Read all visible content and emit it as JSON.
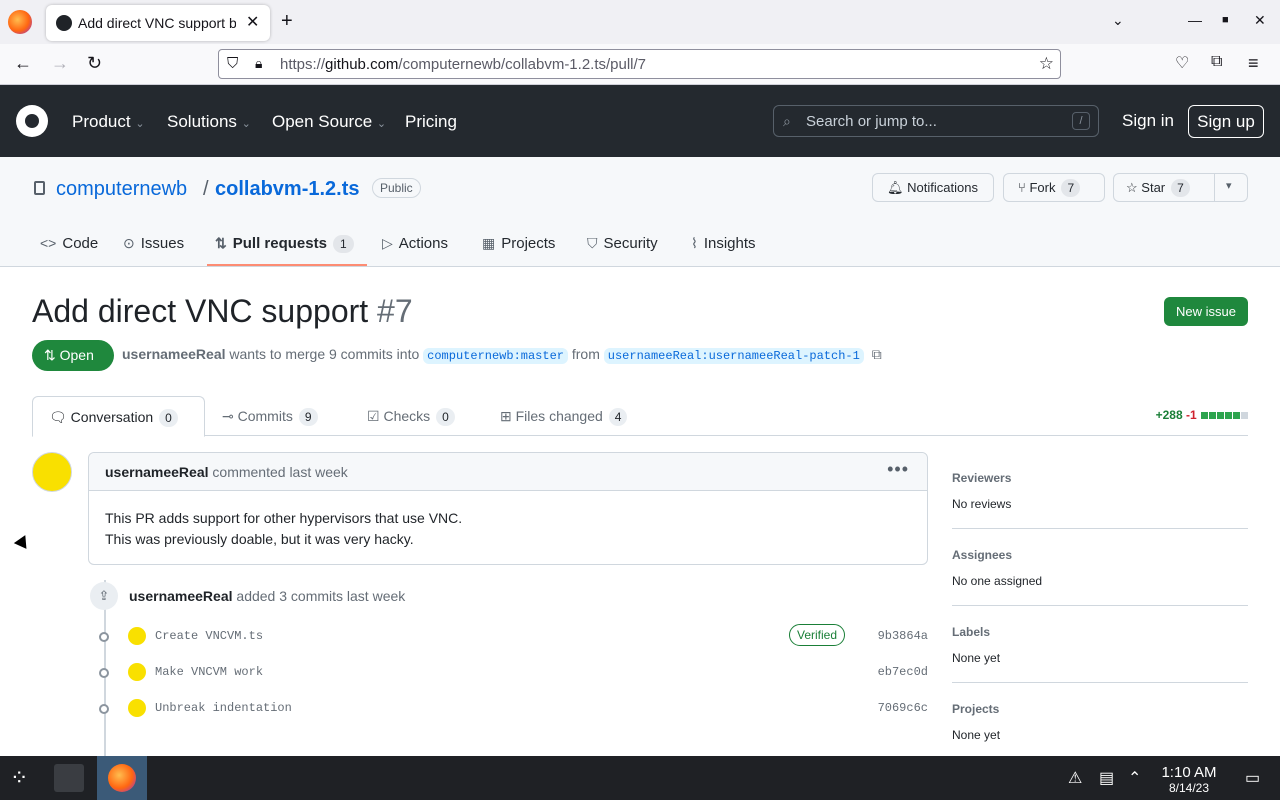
{
  "browser": {
    "tab_title": "Add direct VNC support b",
    "tab_close": "✕",
    "new_tab": "+",
    "url_prefix": "https://",
    "url_domain": "github.com",
    "url_path": "/computernewb/collabvm-1.2.ts/pull/7"
  },
  "github_header": {
    "nav": [
      "Product",
      "Solutions",
      "Open Source",
      "Pricing"
    ],
    "search_placeholder": "Search or jump to...",
    "search_shortcut": "/",
    "sign_in": "Sign in",
    "sign_up": "Sign up"
  },
  "repo": {
    "owner": "computernewb",
    "separator": "/",
    "name": "collabvm-1.2.ts",
    "visibility": "Public",
    "notifications_label": "Notifications",
    "fork_label": "Fork",
    "fork_count": "7",
    "star_label": "Star",
    "star_count": "7",
    "tabs": {
      "code": "Code",
      "issues": "Issues",
      "pull_requests": "Pull requests",
      "pull_requests_count": "1",
      "actions": "Actions",
      "projects": "Projects",
      "security": "Security",
      "insights": "Insights"
    }
  },
  "pr": {
    "title": "Add direct VNC support",
    "number": "#7",
    "new_issue": "New issue",
    "state": "Open",
    "author": "usernameeReal",
    "merge_text": "wants to merge 9 commits into",
    "base_branch": "computernewb:master",
    "from_text": "from",
    "head_branch": "usernameeReal:usernameeReal-patch-1",
    "tabs": {
      "conversation": "Conversation",
      "conversation_count": "0",
      "commits": "Commits",
      "commits_count": "9",
      "checks": "Checks",
      "checks_count": "0",
      "files_changed": "Files changed",
      "files_changed_count": "4"
    },
    "additions": "+288",
    "deletions": "-1"
  },
  "comment": {
    "author": "usernameeReal",
    "action": "commented last week",
    "body_line1": "This PR adds support for other hypervisors that use VNC.",
    "body_line2": "This was previously doable, but it was very hacky."
  },
  "timeline": {
    "author": "usernameeReal",
    "event": "added 3 commits last week",
    "commits": [
      {
        "message": "Create VNCVM.ts",
        "sha": "9b3864a",
        "badge": "Verified"
      },
      {
        "message": "Make VNCVM work",
        "sha": "eb7ec0d"
      },
      {
        "message": "Unbreak indentation",
        "sha": "7069c6c"
      }
    ]
  },
  "sidebar": {
    "reviewers_label": "Reviewers",
    "reviewers_value": "No reviews",
    "assignees_label": "Assignees",
    "assignees_value": "No one assigned",
    "labels_label": "Labels",
    "labels_value": "None yet",
    "projects_label": "Projects",
    "projects_value": "None yet"
  },
  "taskbar": {
    "time": "1:10 AM",
    "date": "8/14/23"
  },
  "colors": {
    "github_dark": "#24292f",
    "open_green": "#1f883d",
    "link_blue": "#0969da",
    "pr_tab_underline": "#fd8c73"
  }
}
